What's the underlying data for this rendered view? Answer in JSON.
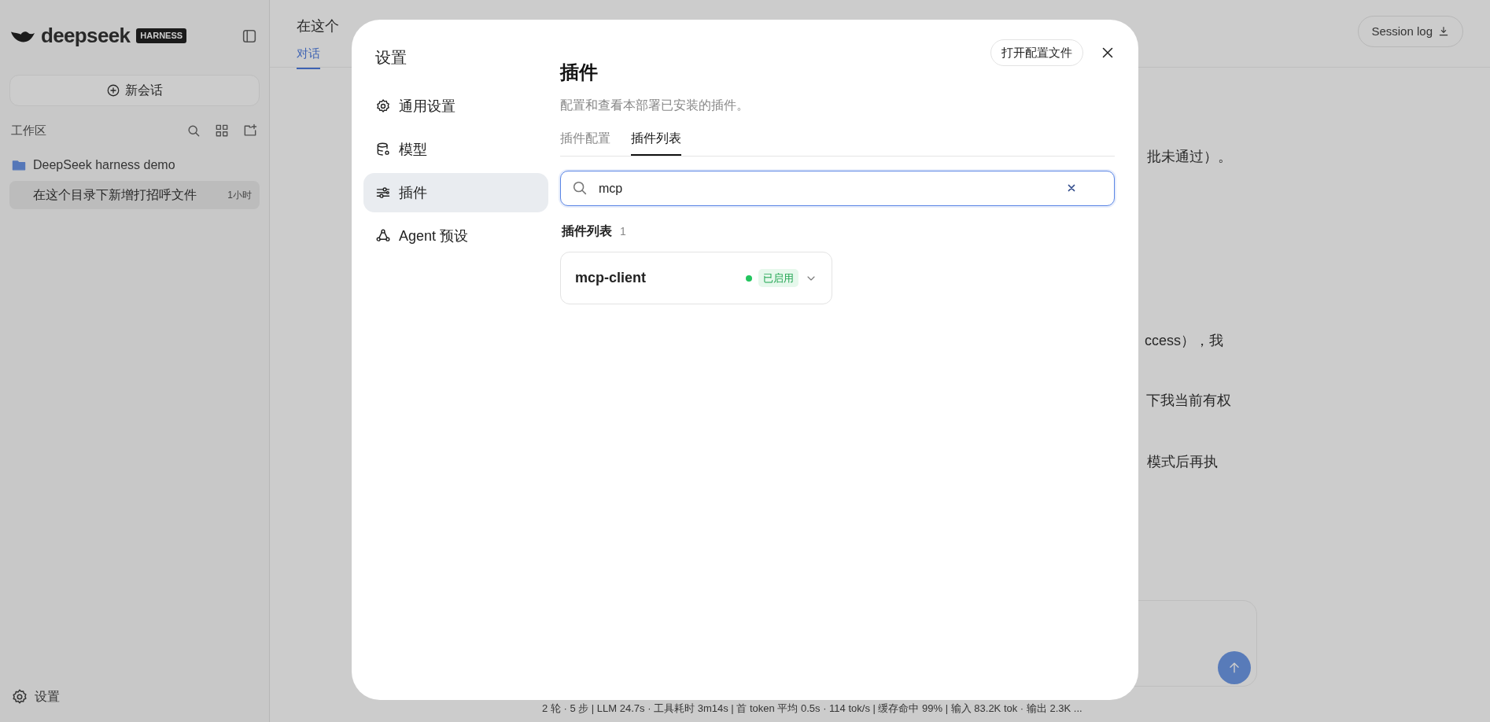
{
  "sidebar": {
    "logo": "deepseek",
    "badge": "HARNESS",
    "new_chat": "新会话",
    "section": "工作区",
    "workspaces": [
      {
        "name": "DeepSeek harness demo",
        "children": [
          {
            "title": "在这个目录下新增打招呼文件",
            "time": "1小时",
            "selected": true
          }
        ]
      }
    ],
    "settings": "设置"
  },
  "header": {
    "title": "在这个",
    "tabs": [
      {
        "label": "对话",
        "selected": true
      }
    ],
    "session_log": "Session log"
  },
  "messages": [
    "批未通过）。",
    "ccess），我",
    "下我当前有权",
    "模式后再执"
  ],
  "status_bar": "2 轮 · 5 步  |  LLM 24.7s · 工具耗时 3m14s  |  首 token 平均 0.5s · 114 tok/s  |  缓存命中 99%  |  输入 83.2K tok · 输出 2.3K ...",
  "dialog": {
    "title": "设置",
    "open_config": "打开配置文件",
    "nav": [
      {
        "label": "通用设置",
        "selected": false
      },
      {
        "label": "模型",
        "selected": false
      },
      {
        "label": "插件",
        "selected": true
      },
      {
        "label": "Agent 预设",
        "selected": false
      }
    ],
    "heading": "插件",
    "description": "配置和查看本部署已安装的插件。",
    "tabs": [
      {
        "label": "插件配置",
        "selected": false
      },
      {
        "label": "插件列表",
        "selected": true
      }
    ],
    "search": {
      "value": "mcp"
    },
    "list_title": "插件列表",
    "list_count": "1",
    "plugins": [
      {
        "name": "mcp-client",
        "enabled": true,
        "status": "已启用"
      }
    ]
  }
}
